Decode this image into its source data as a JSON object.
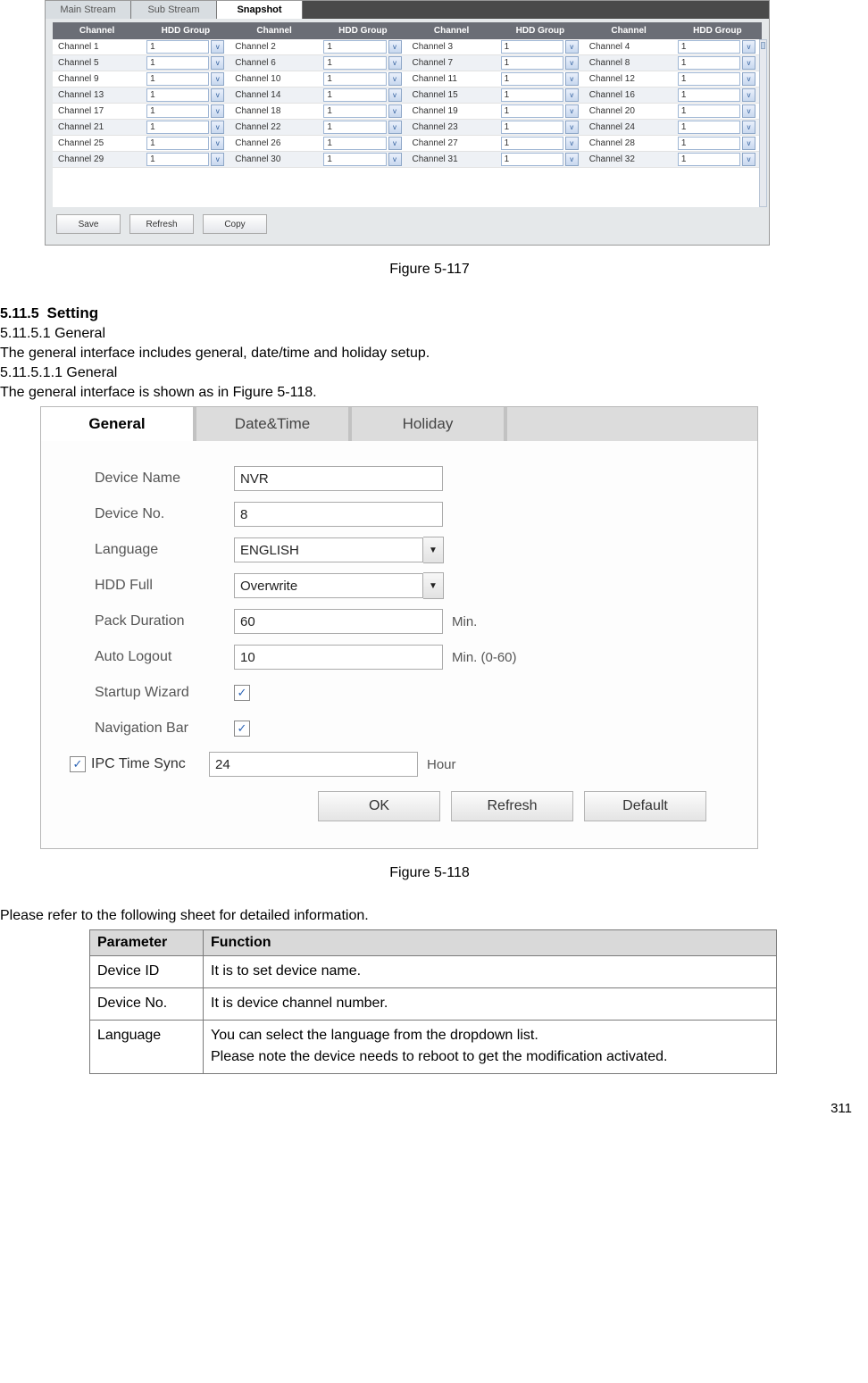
{
  "fig1": {
    "tabs": [
      "Main Stream",
      "Sub Stream",
      "Snapshot"
    ],
    "active_tab_index": 2,
    "headers": [
      "Channel",
      "HDD Group",
      "Channel",
      "HDD Group",
      "Channel",
      "HDD Group",
      "Channel",
      "HDD Group"
    ],
    "rows": [
      [
        {
          "name": "Channel 1",
          "val": "1"
        },
        {
          "name": "Channel 2",
          "val": "1"
        },
        {
          "name": "Channel 3",
          "val": "1"
        },
        {
          "name": "Channel 4",
          "val": "1"
        }
      ],
      [
        {
          "name": "Channel 5",
          "val": "1"
        },
        {
          "name": "Channel 6",
          "val": "1"
        },
        {
          "name": "Channel 7",
          "val": "1"
        },
        {
          "name": "Channel 8",
          "val": "1"
        }
      ],
      [
        {
          "name": "Channel 9",
          "val": "1"
        },
        {
          "name": "Channel 10",
          "val": "1"
        },
        {
          "name": "Channel 11",
          "val": "1"
        },
        {
          "name": "Channel 12",
          "val": "1"
        }
      ],
      [
        {
          "name": "Channel 13",
          "val": "1"
        },
        {
          "name": "Channel 14",
          "val": "1"
        },
        {
          "name": "Channel 15",
          "val": "1"
        },
        {
          "name": "Channel 16",
          "val": "1"
        }
      ],
      [
        {
          "name": "Channel 17",
          "val": "1"
        },
        {
          "name": "Channel 18",
          "val": "1"
        },
        {
          "name": "Channel 19",
          "val": "1"
        },
        {
          "name": "Channel 20",
          "val": "1"
        }
      ],
      [
        {
          "name": "Channel 21",
          "val": "1"
        },
        {
          "name": "Channel 22",
          "val": "1"
        },
        {
          "name": "Channel 23",
          "val": "1"
        },
        {
          "name": "Channel 24",
          "val": "1"
        }
      ],
      [
        {
          "name": "Channel 25",
          "val": "1"
        },
        {
          "name": "Channel 26",
          "val": "1"
        },
        {
          "name": "Channel 27",
          "val": "1"
        },
        {
          "name": "Channel 28",
          "val": "1"
        }
      ],
      [
        {
          "name": "Channel 29",
          "val": "1"
        },
        {
          "name": "Channel 30",
          "val": "1"
        },
        {
          "name": "Channel 31",
          "val": "1"
        },
        {
          "name": "Channel 32",
          "val": "1"
        }
      ]
    ],
    "buttons": [
      "Save",
      "Refresh",
      "Copy"
    ],
    "caption": "Figure 5-117"
  },
  "text": {
    "sec_num": "5.11.5",
    "sec_title": "Setting",
    "sub1": "5.11.5.1  General",
    "p1": "The general interface includes general, date/time and holiday setup.",
    "sub2": "5.11.5.1.1   General",
    "p2": "The general interface is shown as in Figure 5-118."
  },
  "fig2": {
    "tabs": [
      "General",
      "Date&Time",
      "Holiday"
    ],
    "active_tab_index": 0,
    "fields": {
      "device_name": {
        "label": "Device Name",
        "value": "NVR"
      },
      "device_no": {
        "label": "Device No.",
        "value": "8"
      },
      "language": {
        "label": "Language",
        "value": "ENGLISH"
      },
      "hdd_full": {
        "label": "HDD Full",
        "value": "Overwrite"
      },
      "pack_duration": {
        "label": "Pack Duration",
        "value": "60",
        "suffix": "Min."
      },
      "auto_logout": {
        "label": "Auto Logout",
        "value": "10",
        "suffix": "Min. (0-60)"
      },
      "startup_wizard": {
        "label": "Startup Wizard",
        "checked": true
      },
      "navigation_bar": {
        "label": "Navigation Bar",
        "checked": true
      },
      "ipc_time_sync": {
        "label": "IPC Time Sync",
        "prechecked": true,
        "value": "24",
        "suffix": "Hour"
      }
    },
    "buttons": [
      "OK",
      "Refresh",
      "Default"
    ],
    "caption": "Figure 5-118"
  },
  "after": {
    "lead": "Please refer to the following sheet for detailed information.",
    "table": {
      "headers": [
        "Parameter",
        "Function"
      ],
      "rows": [
        {
          "param": "Device ID",
          "func": "It is to set device name."
        },
        {
          "param": "Device No.",
          "func": "It is device channel number."
        },
        {
          "param": "Language",
          "func": "You can select the language from the dropdown list.\nPlease note the device needs to reboot to get the modification activated."
        }
      ]
    }
  },
  "page_number": "311"
}
